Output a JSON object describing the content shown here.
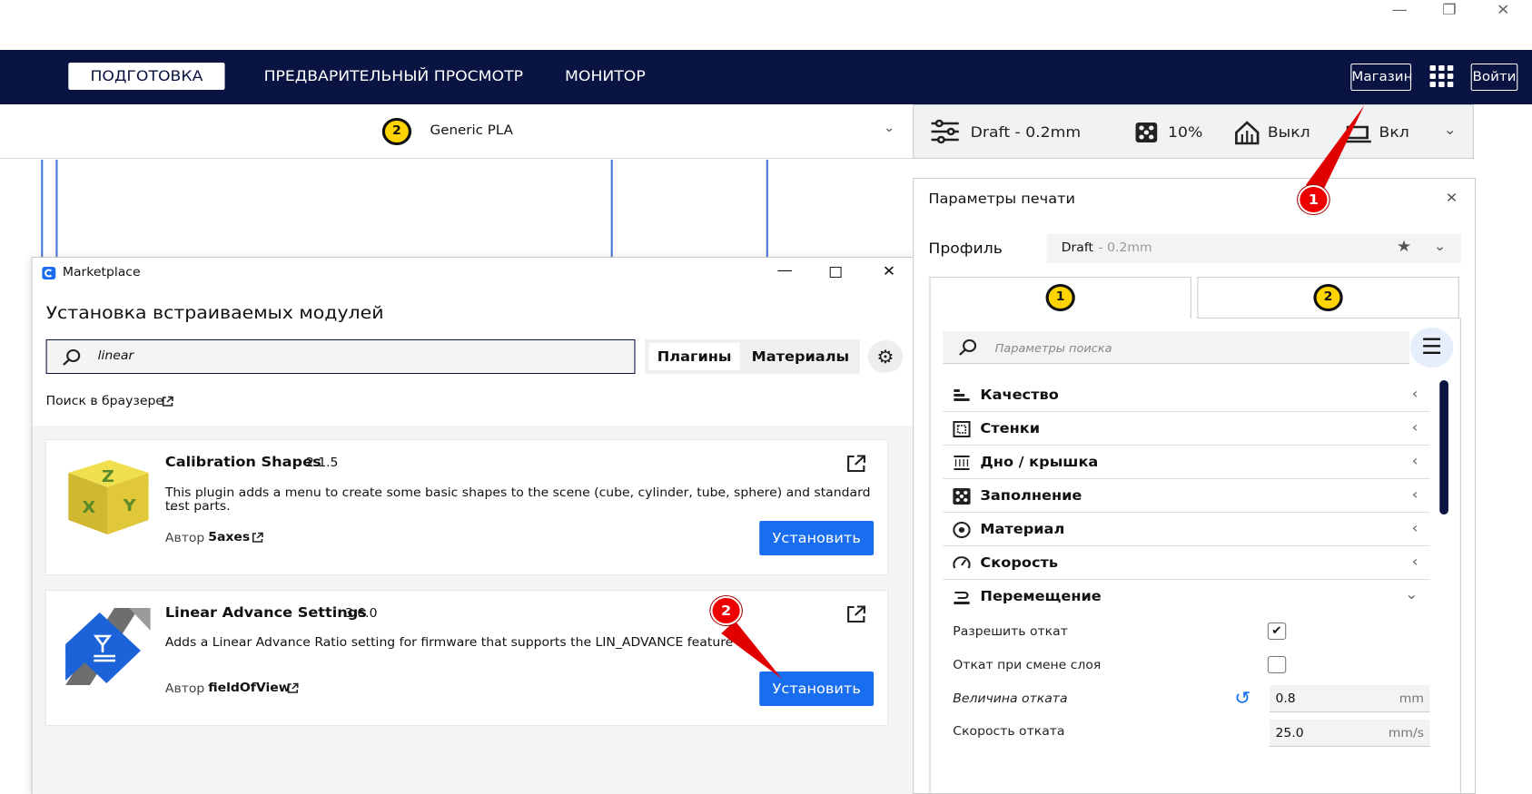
{
  "window": {
    "minimize": "—",
    "restore": "❐",
    "close": "✕"
  },
  "nav": {
    "tabs": [
      "ПОДГОТОВКА",
      "ПРЕДВАРИТЕЛЬНЫЙ ПРОСМОТР",
      "МОНИТОР"
    ],
    "shop": "Магазин",
    "login": "Войти"
  },
  "material": {
    "extruder": "2",
    "name": "Generic PLA"
  },
  "printbar": {
    "profile": "Draft - 0.2mm",
    "infill": "10%",
    "support": "Выкл",
    "adhesion": "Вкл"
  },
  "marketplace": {
    "window_title": "Marketplace",
    "heading": "Установка встраиваемых модулей",
    "search_value": "linear",
    "tab_plugins": "Плагины",
    "tab_materials": "Материалы",
    "browser_link": "Поиск в браузере",
    "plugins": [
      {
        "name": "Calibration Shapes",
        "version": "2.1.5",
        "description": "This plugin adds a menu to create some basic shapes to the scene (cube, cylinder, tube, sphere) and standard test parts.",
        "more": "...",
        "author_label": "Автор",
        "author": "5axes",
        "install": "Установить"
      },
      {
        "name": "Linear Advance Settings",
        "version": "3.6.0",
        "description": "Adds a Linear Advance Ratio setting for firmware that supports the LIN_ADVANCE feature",
        "author_label": "Автор",
        "author": "fieldOfView",
        "install": "Установить"
      }
    ]
  },
  "markers": [
    "1",
    "2"
  ],
  "panel": {
    "title": "Параметры печати",
    "profile_label": "Профиль",
    "profile_value": "Draft",
    "profile_sub": " - 0.2mm",
    "extruder_tabs": [
      "1",
      "2"
    ],
    "search_placeholder": "Параметры поиска",
    "sections": [
      "Качество",
      "Стенки",
      "Дно / крышка",
      "Заполнение",
      "Материал",
      "Скорость",
      "Перемещение"
    ],
    "settings": {
      "retract_enable": "Разрешить откат",
      "retract_layer": "Откат при смене слоя",
      "retract_dist": "Величина отката",
      "retract_dist_value": "0.8",
      "retract_dist_unit": "mm",
      "retract_speed": "Скорость отката",
      "retract_speed_value": "25.0",
      "retract_speed_unit": "mm/s"
    }
  },
  "colors": {
    "nav": "#0a1442",
    "accent": "#196ef0",
    "badge": "#ffd400",
    "marker": "#e00000"
  }
}
